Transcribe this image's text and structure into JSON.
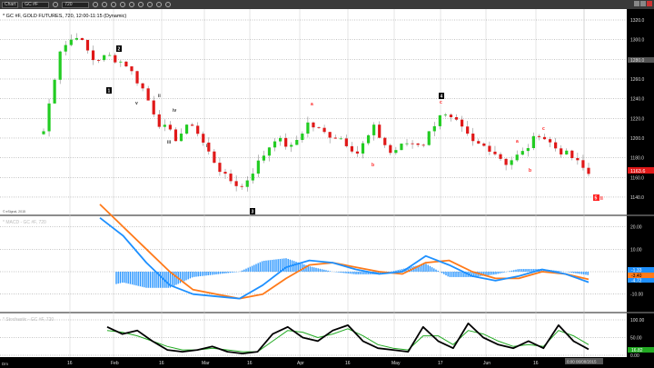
{
  "toolbar": {
    "app_label": "Chart",
    "symbol": "GC #F",
    "interval": "720",
    "icons": [
      "zoom-icon",
      "draw-icon",
      "cursor-icon",
      "layout-icon",
      "info-icon",
      "settings-icon",
      "link-icon",
      "comment-icon",
      "twitter-icon",
      "facebook-icon"
    ]
  },
  "price_panel": {
    "title": "* GC #F, GOLD FUTURES, 720, 12:00-11:15 (Dynamic)",
    "watermark": "© eSignal, 2015",
    "last_price": "1163.6",
    "crosshair_price": "1280.0",
    "wave_labels": [
      "1",
      "2",
      "3",
      "4",
      "5",
      "II",
      "i",
      "ii",
      "iii",
      "iv",
      "v",
      "a",
      "b",
      "c"
    ]
  },
  "macd_panel": {
    "title": "* MACD - GC #F, 720",
    "values": [
      "-1.33",
      "-3.40",
      "-4.72"
    ]
  },
  "stoch_panel": {
    "title": "* Stochastic - GC #F, 720",
    "value": "16.82"
  },
  "date_axis": {
    "labels": [
      "16",
      "Feb",
      "16",
      "Mar",
      "16",
      "Apr",
      "16",
      "May",
      "17",
      "Jun",
      "16"
    ],
    "left_label": "Dm",
    "crosshair_date": "0:00 06/08/2015"
  },
  "colors": {
    "up": "#22cc22",
    "down": "#e01818",
    "macd": "#1e90ff",
    "signal": "#ff7a1a",
    "stoch_k": "#000000",
    "stoch_d": "#22aa22"
  },
  "chart_data": [
    {
      "type": "candlestick",
      "title": "* GC #F, GOLD FUTURES, 720, 12:00-11:15 (Dynamic)",
      "ylim": [
        1130,
        1330
      ],
      "yticks": [
        1140,
        1160,
        1180,
        1200,
        1220,
        1240,
        1260,
        1280,
        1300,
        1320
      ],
      "swing_closes": [
        1207,
        1290,
        1305,
        1280,
        1283,
        1275,
        1250,
        1215,
        1200,
        1215,
        1185,
        1160,
        1150,
        1175,
        1200,
        1190,
        1215,
        1205,
        1200,
        1185,
        1210,
        1185,
        1195,
        1195,
        1225,
        1215,
        1195,
        1190,
        1175,
        1185,
        1205,
        1190,
        1180,
        1163.6
      ]
    },
    {
      "type": "line",
      "title": "* MACD - GC #F, 720",
      "ylim": [
        -15,
        25
      ],
      "yticks": [
        20,
        10,
        0,
        -10
      ],
      "series": [
        {
          "values": [
            24,
            16,
            4,
            -6,
            -10,
            -11,
            -12,
            -6,
            2,
            5,
            4,
            1,
            -1,
            0,
            7,
            3,
            -2,
            -4,
            -2,
            1,
            -1,
            -4.7
          ]
        },
        {
          "values": [
            30,
            20,
            10,
            0,
            -8,
            -10,
            -12,
            -10,
            -3,
            3,
            4,
            2,
            0,
            -1,
            4,
            5,
            0,
            -3,
            -3,
            0,
            -1,
            -3.4
          ]
        }
      ],
      "histogram_last": -1.33
    },
    {
      "type": "line",
      "title": "* Stochastic - GC #F, 720",
      "ylim": [
        0,
        100
      ],
      "yticks": [
        100,
        50,
        0
      ],
      "series": [
        {
          "values": [
            80,
            60,
            70,
            40,
            15,
            10,
            15,
            25,
            10,
            5,
            10,
            60,
            80,
            50,
            40,
            70,
            85,
            40,
            20,
            15,
            10,
            80,
            40,
            20,
            90,
            50,
            30,
            20,
            40,
            20,
            85,
            40,
            16.8
          ]
        },
        {
          "values": [
            70,
            65,
            55,
            40,
            25,
            15,
            15,
            20,
            15,
            10,
            10,
            40,
            70,
            65,
            50,
            60,
            75,
            55,
            30,
            20,
            15,
            55,
            55,
            30,
            70,
            60,
            40,
            25,
            30,
            25,
            70,
            55,
            30
          ]
        }
      ]
    }
  ]
}
